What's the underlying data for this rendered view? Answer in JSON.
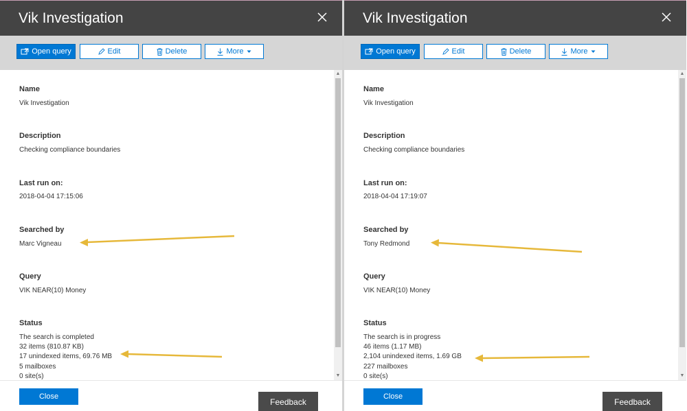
{
  "colors": {
    "header_bg": "#444444",
    "accent": "#0078d4",
    "toolbar_bg": "#d6d6d6",
    "annotation_arrow": "#e6b83a",
    "feedback_bg": "#4a4a4a"
  },
  "panels": [
    {
      "title": "Vik Investigation",
      "toolbar": {
        "open_query": "Open query",
        "edit": "Edit",
        "delete": "Delete",
        "more": "More"
      },
      "fields": {
        "name_label": "Name",
        "name_value": "Vik Investigation",
        "description_label": "Description",
        "description_value": "Checking compliance boundaries",
        "last_run_label": "Last run on:",
        "last_run_value": "2018-04-04 17:15:06",
        "searched_by_label": "Searched by",
        "searched_by_value": "Marc Vigneau",
        "query_label": "Query",
        "query_value": "VIK NEAR(10) Money",
        "status_label": "Status",
        "status_lines": [
          "The search is completed",
          "32 items (810.87 KB)",
          "17 unindexed items, 69.76 MB",
          "5 mailboxes",
          "0 site(s)"
        ]
      },
      "footer": {
        "close": "Close",
        "feedback": "Feedback"
      }
    },
    {
      "title": "Vik Investigation",
      "toolbar": {
        "open_query": "Open query",
        "edit": "Edit",
        "delete": "Delete",
        "more": "More"
      },
      "fields": {
        "name_label": "Name",
        "name_value": "Vik Investigation",
        "description_label": "Description",
        "description_value": "Checking compliance boundaries",
        "last_run_label": "Last run on:",
        "last_run_value": "2018-04-04 17:19:07",
        "searched_by_label": "Searched by",
        "searched_by_value": "Tony Redmond",
        "query_label": "Query",
        "query_value": "VIK NEAR(10) Money",
        "status_label": "Status",
        "status_lines": [
          "The search is in progress",
          "46 items (1.17 MB)",
          "2,104 unindexed items, 1.69 GB",
          "227 mailboxes",
          "0 site(s)"
        ]
      },
      "footer": {
        "close": "Close",
        "feedback": "Feedback"
      }
    }
  ]
}
